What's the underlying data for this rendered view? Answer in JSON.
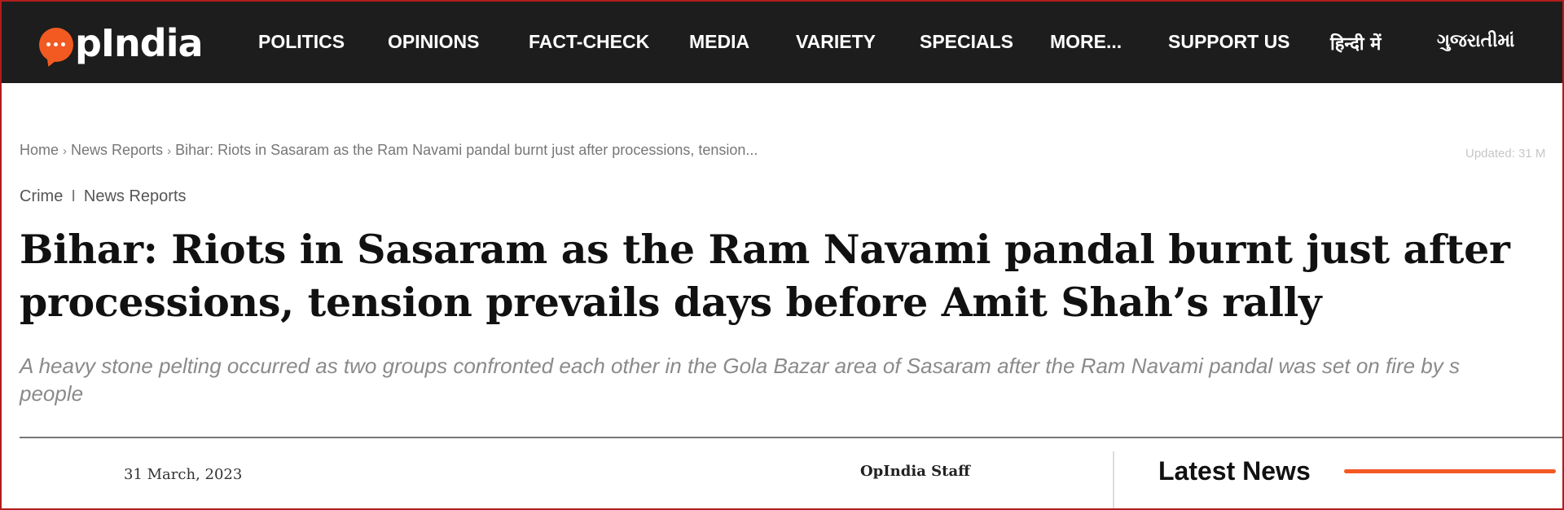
{
  "nav": {
    "logo_text": "pIndia",
    "items": [
      "POLITICS",
      "OPINIONS",
      "FACT-CHECK",
      "MEDIA",
      "VARIETY",
      "SPECIALS",
      "MORE...",
      "SUPPORT US",
      "हिन्दी में",
      "ગુજરાતીમાં"
    ]
  },
  "breadcrumb": {
    "home": "Home",
    "section": "News Reports",
    "current": "Bihar: Riots in Sasaram as the Ram Navami pandal burnt just after processions, tension..."
  },
  "updated": "Updated: 31 M",
  "categories": [
    "Crime",
    "News Reports"
  ],
  "article": {
    "headline_line1": "Bihar: Riots in Sasaram as the Ram Navami pandal burnt just after",
    "headline_line2": "processions, tension prevails days before Amit Shah’s rally",
    "subtitle_line1": "A heavy stone pelting occurred as two groups confronted each other in the Gola Bazar area of Sasaram after the Ram Navami pandal was set on fire by s",
    "subtitle_line2": "people",
    "date": "31 March, 2023",
    "author": "OpIndia Staff"
  },
  "sidebar": {
    "latest_title": "Latest News"
  },
  "colors": {
    "nav_bg": "#1d1d1d",
    "accent": "#f25a22",
    "frame_border": "#b11d1d"
  }
}
